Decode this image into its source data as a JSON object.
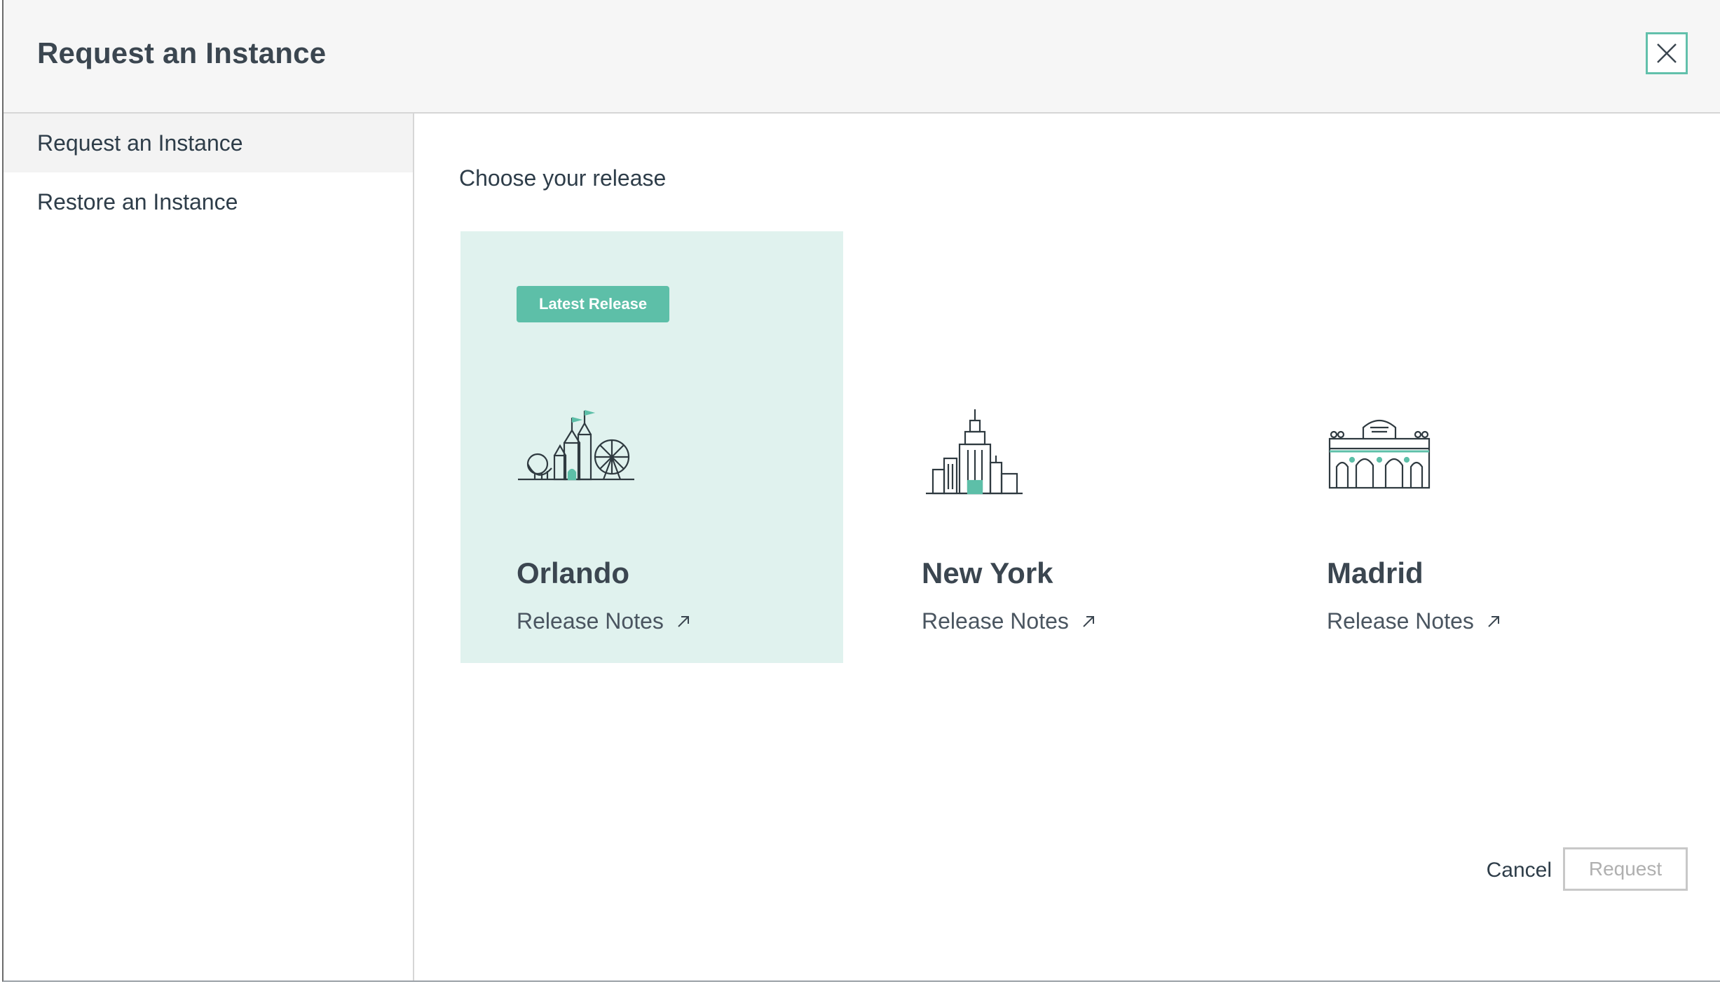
{
  "dialog": {
    "title": "Request an Instance",
    "close_icon": "close-icon"
  },
  "sidebar": {
    "items": [
      {
        "label": "Request an Instance",
        "active": true
      },
      {
        "label": "Restore an Instance",
        "active": false
      }
    ]
  },
  "main": {
    "heading": "Choose your release",
    "releases": [
      {
        "name": "Orlando",
        "badge": "Latest Release",
        "notes": "Release Notes",
        "icon": "orlando-castle-icon",
        "selected": true
      },
      {
        "name": "New York",
        "notes": "Release Notes",
        "icon": "new-york-skyline-icon",
        "selected": false
      },
      {
        "name": "Madrid",
        "notes": "Release Notes",
        "icon": "madrid-gate-icon",
        "selected": false
      }
    ]
  },
  "footer": {
    "cancel_label": "Cancel",
    "request_label": "Request"
  },
  "colors": {
    "accent": "#5dbfa8",
    "selected_card_bg": "#e0f2ee",
    "text": "#2e3d49",
    "disabled": "#b0b0b0"
  }
}
